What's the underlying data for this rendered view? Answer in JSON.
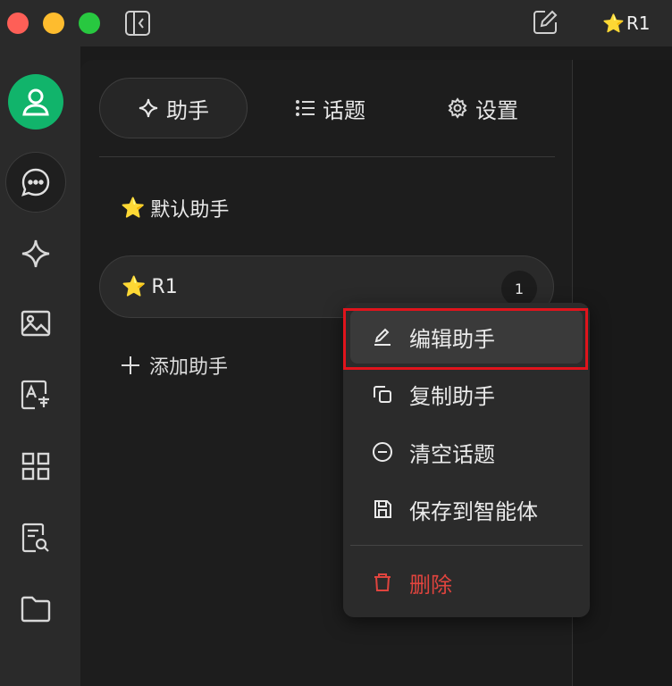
{
  "titlebar": {
    "model_star": "⭐",
    "model_name": "R1"
  },
  "tabs": {
    "assistant": "助手",
    "topics": "话题",
    "settings": "设置"
  },
  "assistants": {
    "default": {
      "star": "⭐",
      "name": "默认助手"
    },
    "r1": {
      "star": "⭐",
      "name": "R1",
      "count": "1"
    },
    "add_label": "添加助手"
  },
  "context_menu": {
    "edit": "编辑助手",
    "copy": "复制助手",
    "clear": "清空话题",
    "save": "保存到智能体",
    "delete": "删除"
  },
  "icons": {
    "left_nav": [
      "user-avatar-icon",
      "chat-icon",
      "sparkle-icon",
      "image-icon",
      "translate-icon",
      "apps-grid-icon",
      "document-search-icon",
      "folder-icon"
    ]
  },
  "colors": {
    "avatar": "#11b46b",
    "delete": "#e0443e",
    "highlight": "#e0141c"
  }
}
